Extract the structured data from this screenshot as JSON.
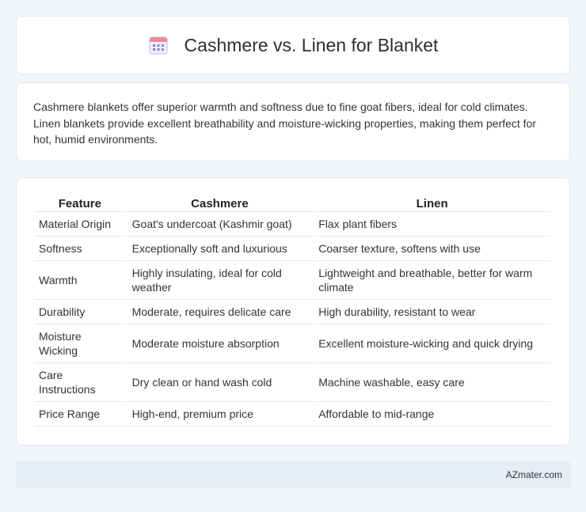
{
  "header": {
    "icon": "calendar-icon",
    "title": "Cashmere vs. Linen for Blanket"
  },
  "intro": {
    "text": "Cashmere blankets offer superior warmth and softness due to fine goat fibers, ideal for cold climates. Linen blankets provide excellent breathability and moisture-wicking properties, making them perfect for hot, humid environments."
  },
  "table": {
    "headers": [
      "Feature",
      "Cashmere",
      "Linen"
    ],
    "rows": [
      [
        "Material Origin",
        "Goat's undercoat (Kashmir goat)",
        "Flax plant fibers"
      ],
      [
        "Softness",
        "Exceptionally soft and luxurious",
        "Coarser texture, softens with use"
      ],
      [
        "Warmth",
        "Highly insulating, ideal for cold weather",
        "Lightweight and breathable, better for warm climate"
      ],
      [
        "Durability",
        "Moderate, requires delicate care",
        "High durability, resistant to wear"
      ],
      [
        "Moisture Wicking",
        "Moderate moisture absorption",
        "Excellent moisture-wicking and quick drying"
      ],
      [
        "Care Instructions",
        "Dry clean or hand wash cold",
        "Machine washable, easy care"
      ],
      [
        "Price Range",
        "High-end, premium price",
        "Affordable to mid-range"
      ]
    ]
  },
  "footer": {
    "source": "AZmater.com"
  },
  "colors": {
    "background": "#f1f4f9",
    "card": "#ffffff",
    "footer": "#e6edf7",
    "icon_accent": "#8b7fd6"
  }
}
